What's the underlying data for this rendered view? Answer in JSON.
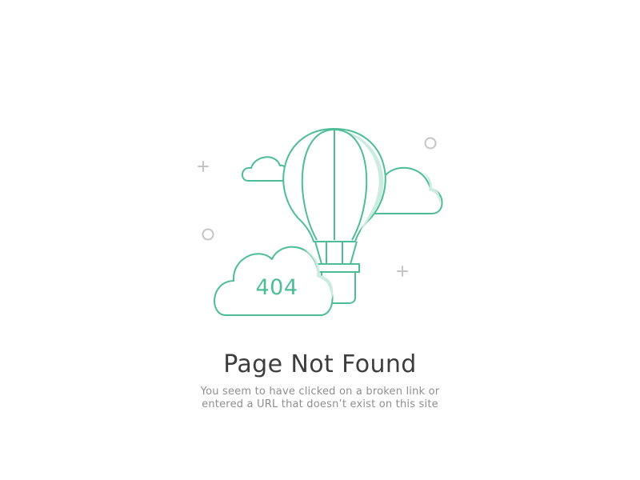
{
  "illustration": {
    "error_code": "404",
    "icons": [
      "hot-air-balloon-icon",
      "cloud-icon",
      "plus-icon",
      "circle-icon"
    ],
    "colors": {
      "accent": "#4dbd98",
      "shadow": "#cdece1",
      "decor": "#c4c4c4"
    }
  },
  "content": {
    "title": "Page Not Found",
    "message_line1": "You seem to have clicked on a broken link or",
    "message_line2": "entered a URL that doesn’t exist on this site"
  }
}
